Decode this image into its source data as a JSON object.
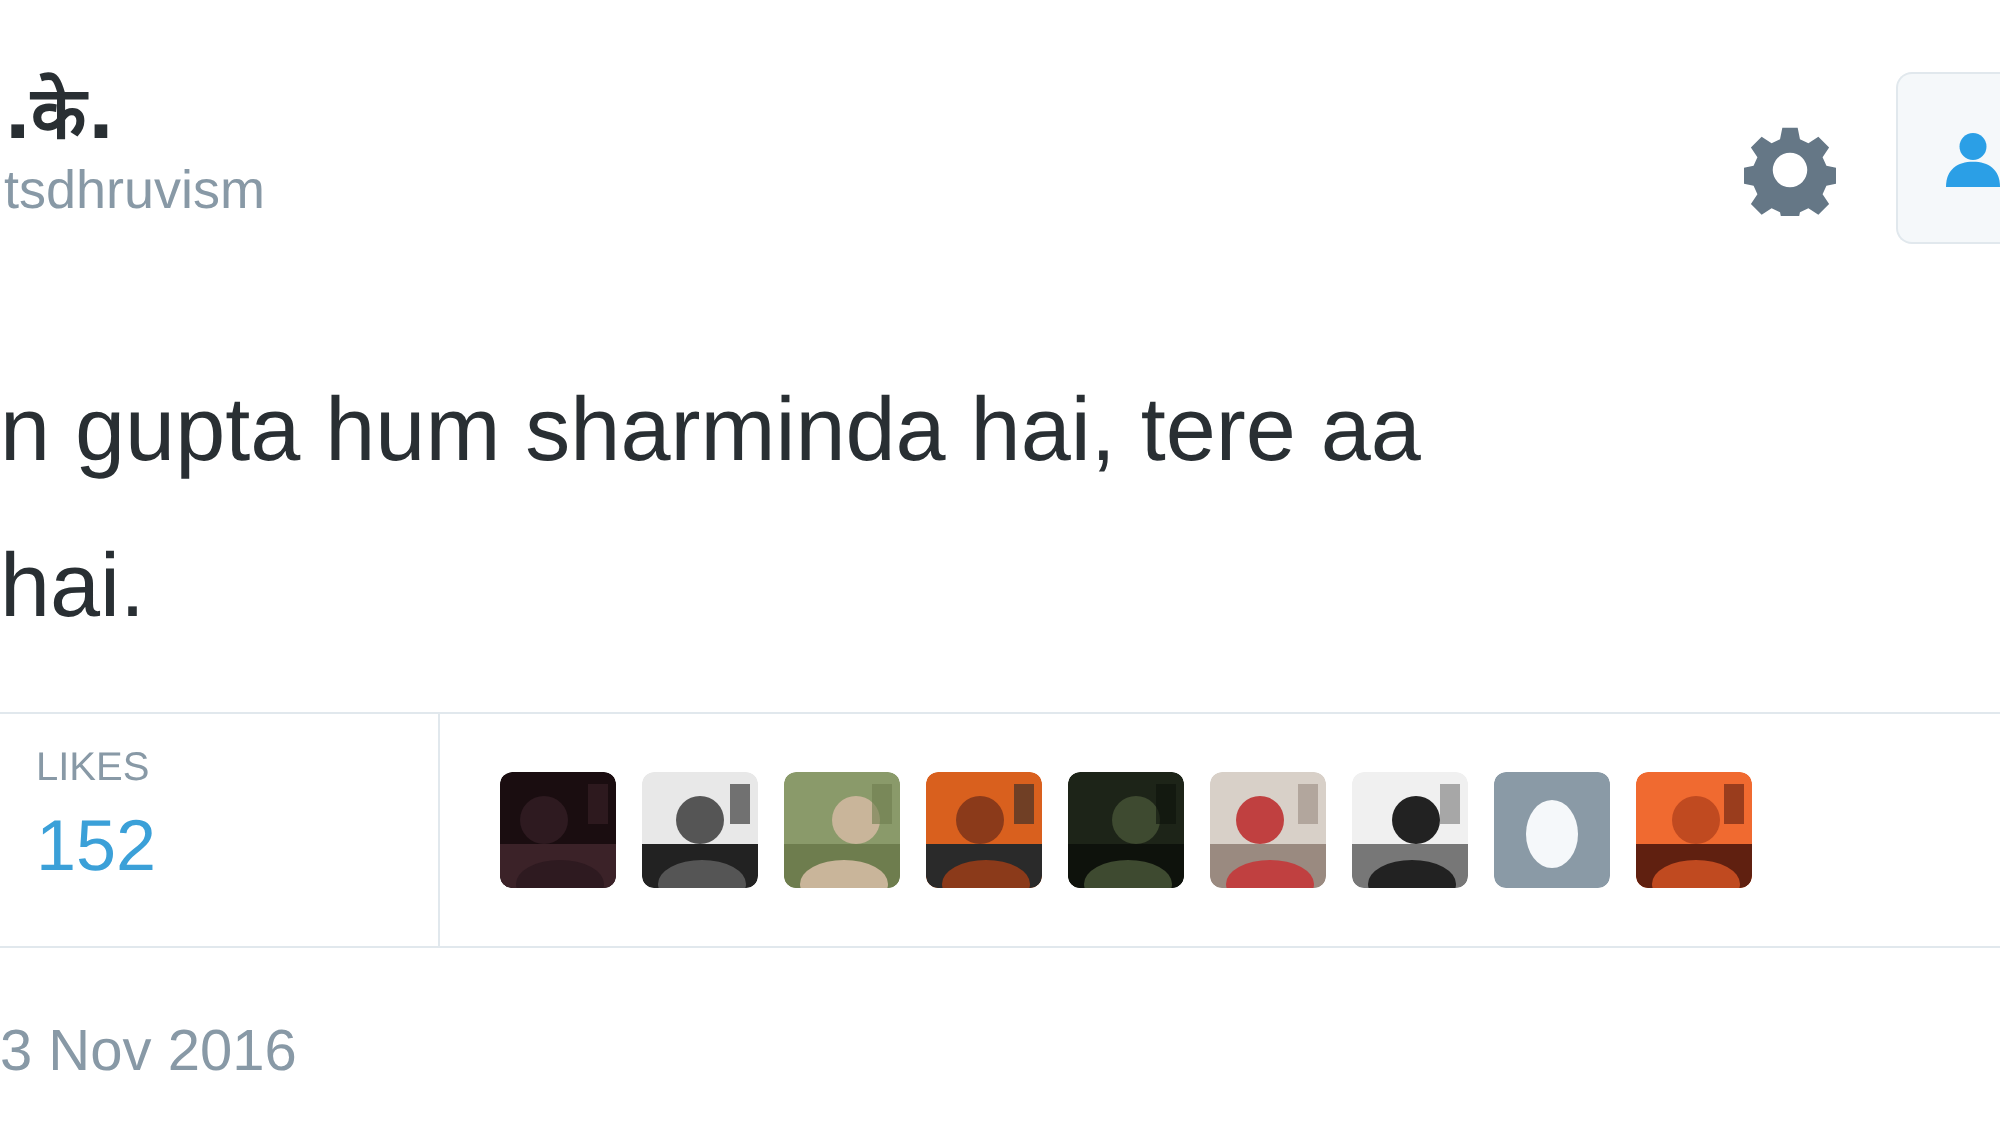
{
  "author": {
    "name": ".के.",
    "handle": "tsdhruvism"
  },
  "tweet": {
    "lines": [
      "n gupta hum sharminda hai, tere aa",
      "hai."
    ]
  },
  "stats": {
    "label": "LIKES",
    "count": "152"
  },
  "likers": [
    {
      "kind": "picture"
    },
    {
      "kind": "picture"
    },
    {
      "kind": "picture"
    },
    {
      "kind": "picture"
    },
    {
      "kind": "picture"
    },
    {
      "kind": "picture"
    },
    {
      "kind": "picture"
    },
    {
      "kind": "egg"
    },
    {
      "kind": "picture"
    }
  ],
  "date": "3 Nov 2016"
}
